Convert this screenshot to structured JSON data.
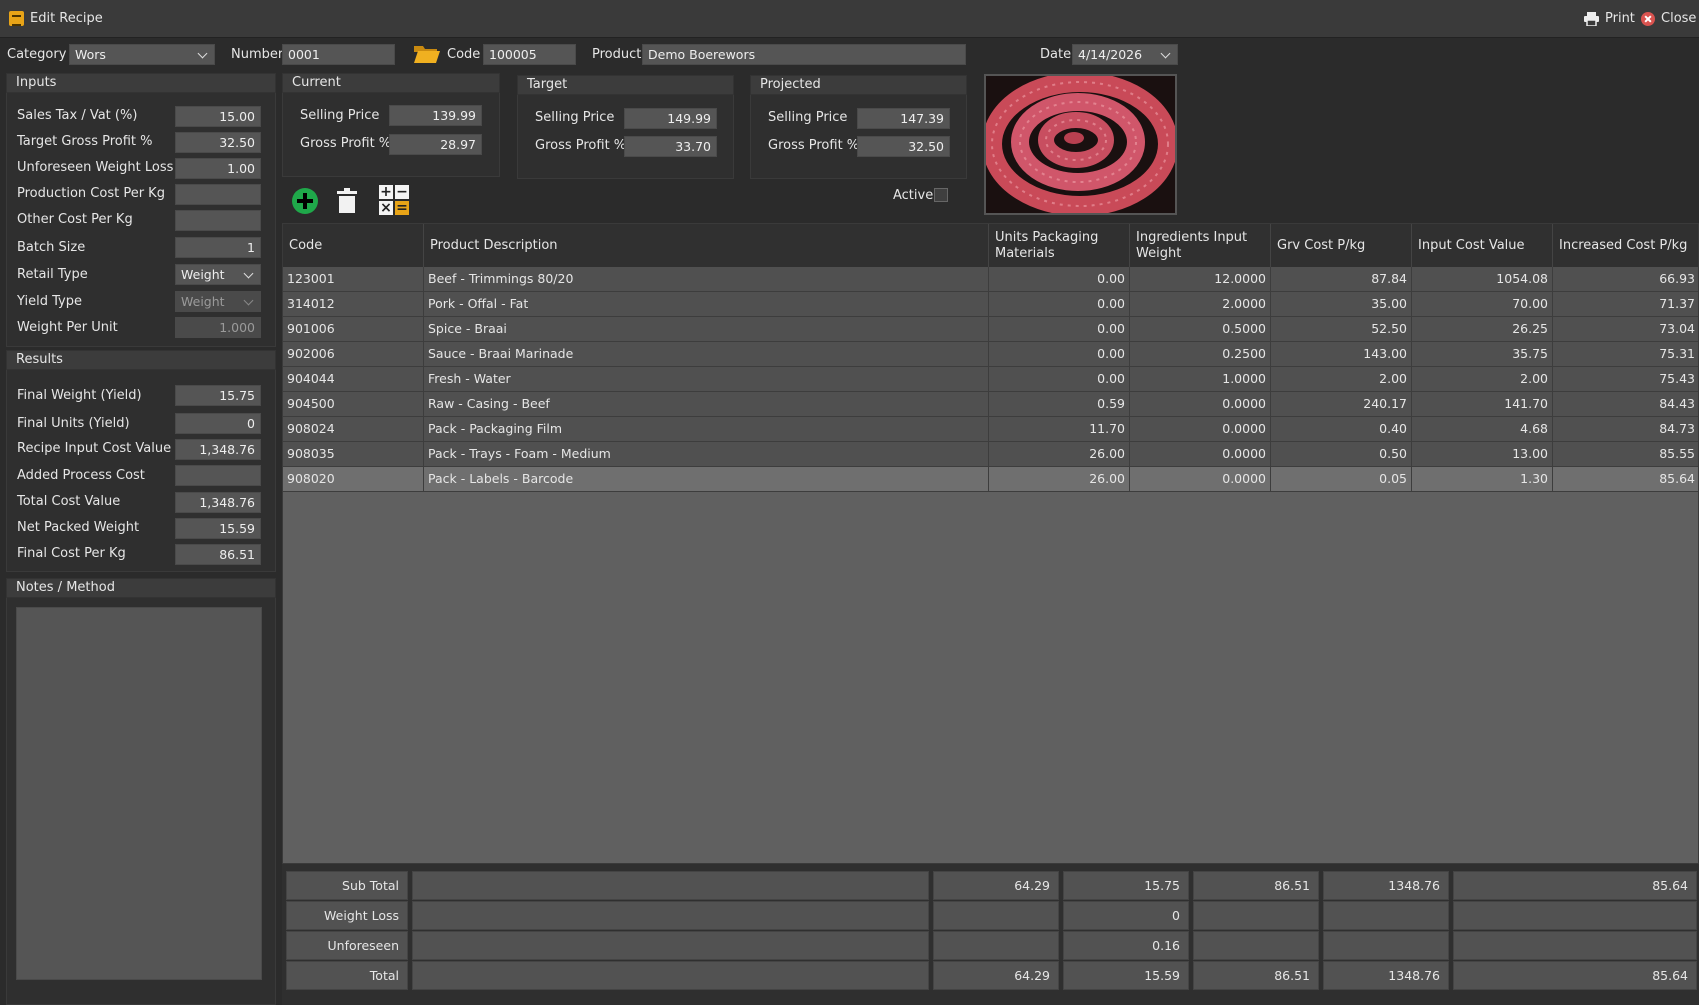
{
  "window": {
    "title": "Edit Recipe",
    "print_label": "Print",
    "close_label": "Close"
  },
  "header": {
    "category_label": "Category",
    "category_value": "Wors",
    "number_label": "Number",
    "number_value": "0001",
    "code_label": "Code",
    "code_value": "100005",
    "product_label": "Product",
    "product_value": "Demo Boerewors",
    "date_label": "Date",
    "date_value": "4/14/2026"
  },
  "inputs": {
    "title": "Inputs",
    "sales_tax_label": "Sales Tax / Vat (%)",
    "sales_tax_value": "15.00",
    "target_gp_label": "Target Gross Profit %",
    "target_gp_value": "32.50",
    "weight_loss_label": "Unforeseen Weight Loss %",
    "weight_loss_value": "1.00",
    "production_cost_label": "Production Cost Per Kg",
    "production_cost_value": "",
    "other_cost_label": "Other Cost Per Kg",
    "other_cost_value": "",
    "batch_size_label": "Batch Size",
    "batch_size_value": "1",
    "retail_type_label": "Retail Type",
    "retail_type_value": "Weight",
    "yield_type_label": "Yield Type",
    "yield_type_value": "Weight",
    "weight_per_unit_label": "Weight Per Unit",
    "weight_per_unit_value": "1.000"
  },
  "results": {
    "title": "Results",
    "final_weight_label": "Final Weight (Yield)",
    "final_weight_value": "15.75",
    "final_units_label": "Final Units (Yield)",
    "final_units_value": "0",
    "input_cost_label": "Recipe Input Cost Value",
    "input_cost_value": "1,348.76",
    "added_process_label": "Added Process Cost",
    "added_process_value": "",
    "total_cost_label": "Total Cost Value",
    "total_cost_value": "1,348.76",
    "net_packed_label": "Net Packed Weight",
    "net_packed_value": "15.59",
    "final_cost_label": "Final Cost Per Kg",
    "final_cost_value": "86.51"
  },
  "notes": {
    "title": "Notes / Method",
    "value": ""
  },
  "current": {
    "title": "Current",
    "sp_label": "Selling Price",
    "sp_value": "139.99",
    "gp_label": "Gross Profit %",
    "gp_value": "28.97"
  },
  "target": {
    "title": "Target",
    "sp_label": "Selling Price",
    "sp_value": "149.99",
    "gp_label": "Gross Profit %",
    "gp_value": "33.70"
  },
  "projected": {
    "title": "Projected",
    "sp_label": "Selling Price",
    "sp_value": "147.39",
    "gp_label": "Gross Profit %",
    "gp_value": "32.50"
  },
  "active_label": "Active",
  "icons": {
    "add": "add-circle-icon",
    "delete": "trash-icon",
    "calc": "calculator-icon",
    "folder": "folder-open-icon",
    "print": "printer-icon",
    "close": "close-icon",
    "app": "recipe-icon"
  },
  "colors": {
    "accent": "#e8a417",
    "add": "#1fa84a",
    "close": "#d9534f"
  },
  "grid": {
    "columns": [
      "Code",
      "Product Description",
      "Units Packaging Materials",
      "Ingredients Input Weight",
      "Grv Cost P/kg",
      "Input Cost Value",
      "Increased Cost P/kg"
    ],
    "rows": [
      [
        "123001",
        "Beef - Trimmings 80/20",
        "0.00",
        "12.0000",
        "87.84",
        "1054.08",
        "66.93"
      ],
      [
        "314012",
        "Pork - Offal - Fat",
        "0.00",
        "2.0000",
        "35.00",
        "70.00",
        "71.37"
      ],
      [
        "901006",
        "Spice - Braai",
        "0.00",
        "0.5000",
        "52.50",
        "26.25",
        "73.04"
      ],
      [
        "902006",
        "Sauce - Braai Marinade",
        "0.00",
        "0.2500",
        "143.00",
        "35.75",
        "75.31"
      ],
      [
        "904044",
        "Fresh - Water",
        "0.00",
        "1.0000",
        "2.00",
        "2.00",
        "75.43"
      ],
      [
        "904500",
        "Raw - Casing - Beef",
        "0.59",
        "0.0000",
        "240.17",
        "141.70",
        "84.43"
      ],
      [
        "908024",
        "Pack - Packaging Film",
        "11.70",
        "0.0000",
        "0.40",
        "4.68",
        "84.73"
      ],
      [
        "908035",
        "Pack - Trays - Foam - Medium",
        "26.00",
        "0.0000",
        "0.50",
        "13.00",
        "85.55"
      ],
      [
        "908020",
        "Pack - Labels - Barcode",
        "26.00",
        "0.0000",
        "0.05",
        "1.30",
        "85.64"
      ]
    ]
  },
  "totals": [
    [
      "Sub Total",
      "",
      "64.29",
      "15.75",
      "86.51",
      "1348.76",
      "85.64"
    ],
    [
      "Weight Loss",
      "",
      "",
      "0",
      "",
      "",
      ""
    ],
    [
      "Unforeseen",
      "",
      "",
      "0.16",
      "",
      "",
      ""
    ],
    [
      "Total",
      "",
      "64.29",
      "15.59",
      "86.51",
      "1348.76",
      "85.64"
    ]
  ]
}
